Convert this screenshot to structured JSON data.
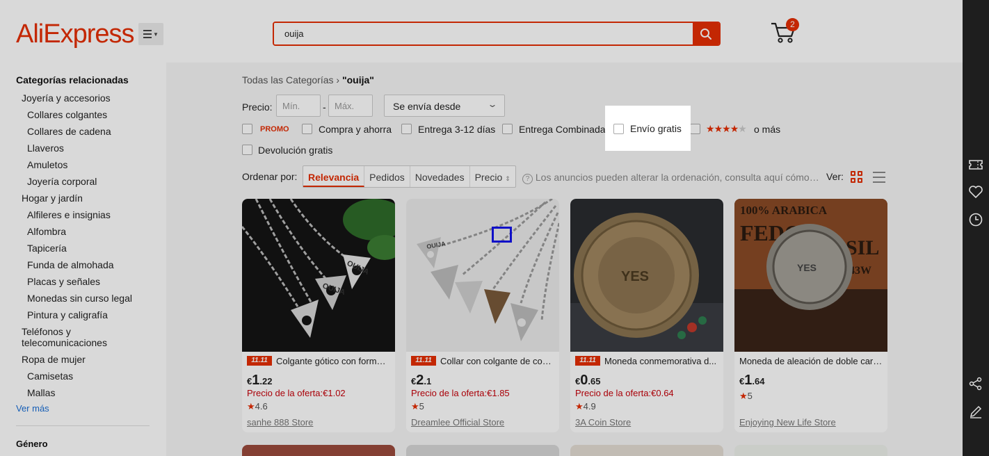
{
  "header": {
    "logo": "AliExpress",
    "search_value": "ouija",
    "cart_count": "2"
  },
  "sidebar": {
    "title": "Categorías relacionadas",
    "items": [
      {
        "label": "Joyería y accesorios",
        "level": 1
      },
      {
        "label": "Collares colgantes",
        "level": 2
      },
      {
        "label": "Collares de cadena",
        "level": 2
      },
      {
        "label": "Llaveros",
        "level": 2
      },
      {
        "label": "Amuletos",
        "level": 2
      },
      {
        "label": "Joyería corporal",
        "level": 2
      },
      {
        "label": "Hogar y jardín",
        "level": 1
      },
      {
        "label": "Alfileres e insignias",
        "level": 2
      },
      {
        "label": "Alfombra",
        "level": 2
      },
      {
        "label": "Tapicería",
        "level": 2
      },
      {
        "label": "Funda de almohada",
        "level": 2
      },
      {
        "label": "Placas y señales",
        "level": 2
      },
      {
        "label": "Monedas sin curso legal",
        "level": 2
      },
      {
        "label": "Pintura y caligrafía",
        "level": 2
      },
      {
        "label": "Teléfonos y",
        "level": 1
      },
      {
        "label": "telecomunicaciones",
        "level": 1
      },
      {
        "label": "Ropa de mujer",
        "level": 1
      },
      {
        "label": "Camisetas",
        "level": 2
      },
      {
        "label": "Mallas",
        "level": 2
      }
    ],
    "more": "Ver más",
    "gender_title": "Género"
  },
  "breadcrumb": {
    "all": "Todas las Categorías",
    "sep": "›",
    "current": "\"ouija\""
  },
  "filters": {
    "price_label": "Precio:",
    "min_placeholder": "Mín.",
    "max_placeholder": "Máx.",
    "dash": "-",
    "ship_from": "Se envía desde",
    "promo": "PROMO",
    "buy_save": "Compra y ahorra",
    "delivery": "Entrega 3-12 días",
    "combined": "Entrega Combinada",
    "free_shipping": "Envío gratis",
    "or_more": "o más",
    "free_return": "Devolución gratis",
    "stars_rating": 4
  },
  "sort": {
    "label": "Ordenar por:",
    "options": [
      "Relevancia",
      "Pedidos",
      "Novedades",
      "Precio"
    ],
    "active": "Relevancia",
    "notice": "Los anuncios pueden alterar la ordenación, consulta aquí cómo or...",
    "view_label": "Ver:"
  },
  "products": [
    {
      "tag": "11.11",
      "title": "Colgante gótico con forma ...",
      "currency": "€",
      "int": "1",
      "dec": ".22",
      "offer": "Precio de la oferta:€1.02",
      "rating": "4.6",
      "store": "sanhe 888 Store"
    },
    {
      "tag": "11.11",
      "title": "Collar con colgante de cora...",
      "currency": "€",
      "int": "2",
      "dec": ".1",
      "offer": "Precio de la oferta:€1.85",
      "rating": "5",
      "store": "Dreamlee Official Store"
    },
    {
      "tag": "11.11",
      "title": "Moneda conmemorativa d...",
      "currency": "€",
      "int": "0",
      "dec": ".65",
      "offer": "Precio de la oferta:€0.64",
      "rating": "4.9",
      "store": "3A Coin Store"
    },
    {
      "tag": "",
      "title": "Moneda de aleación de doble cara...",
      "currency": "€",
      "int": "1",
      "dec": ".64",
      "offer": "",
      "rating": "5",
      "store": "Enjoying New Life Store"
    }
  ],
  "image_text": {
    "p1_a": "OUIJA",
    "p1_b": "OUIJA",
    "p2": "OUIJA",
    "p3": "YES",
    "p4_a": "100% ARABICA",
    "p4_b": "FEDO",
    "p4_c": "SIL",
    "p4_d": "43W",
    "p4_e": "YES"
  },
  "colors": {
    "accent": "#e62e04",
    "offer": "#c7000a",
    "link": "#1a6fd6"
  }
}
